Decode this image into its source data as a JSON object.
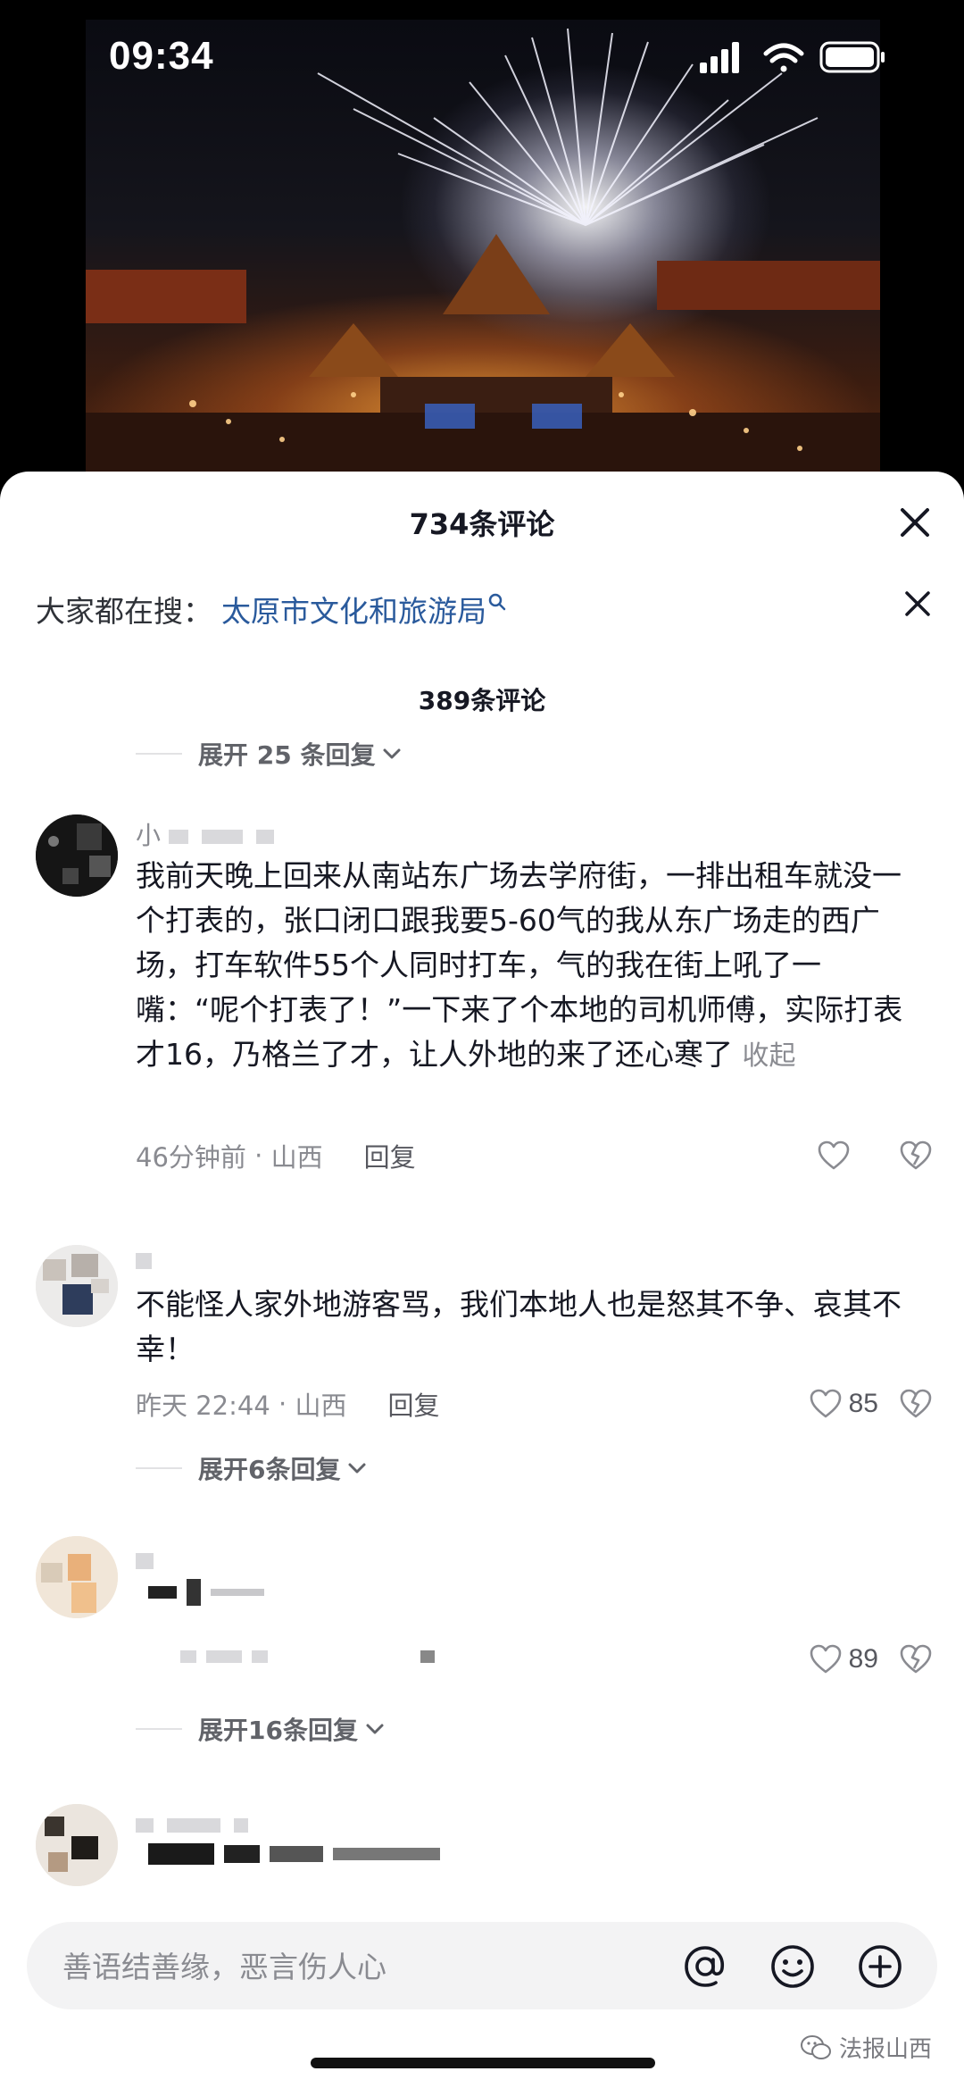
{
  "status_bar": {
    "time": "09:34"
  },
  "panel": {
    "title": "734条评论",
    "search_hint_label": "大家都在搜：",
    "search_hint_link": "太原市文化和旅游局",
    "sub_count": "389条评论"
  },
  "expand_top": {
    "label": "展开 25 条回复"
  },
  "comments": [
    {
      "username": "小",
      "body": "我前天晚上回来从南站东广场去学府街，一排出租车就没一个打表的，张口闭口跟我要5-60气的我从东广场走的西广场，打车软件55个人同时打车，气的我在街上吼了一嘴：“呢个打表了！”一下来了个本地的司机师傅，实际打表才16，乃格兰了才，让人外地的来了还心寒了",
      "collapse": "收起",
      "time": "46分钟前",
      "location": "山西",
      "reply": "回复"
    },
    {
      "body": "不能怪人家外地游客骂，我们本地人也是怒其不争、哀其不幸！",
      "time": "昨天 22:44",
      "location": "山西",
      "reply": "回复",
      "likes": "85",
      "expand": "展开6条回复"
    },
    {
      "likes": "89",
      "expand": "展开16条回复"
    },
    {}
  ],
  "input": {
    "placeholder": "善语结善缘，恶言伤人心"
  },
  "watermark": "法报山西",
  "colors": {
    "link": "#2a5a9c",
    "text": "#161823",
    "secondary": "#8a8b91"
  },
  "icons": [
    "signal-icon",
    "wifi-icon",
    "battery-icon",
    "close-icon",
    "search-icon",
    "chevron-down-icon",
    "heart-icon",
    "broken-heart-icon",
    "at-icon",
    "emoji-icon",
    "plus-icon",
    "wechat-icon"
  ]
}
